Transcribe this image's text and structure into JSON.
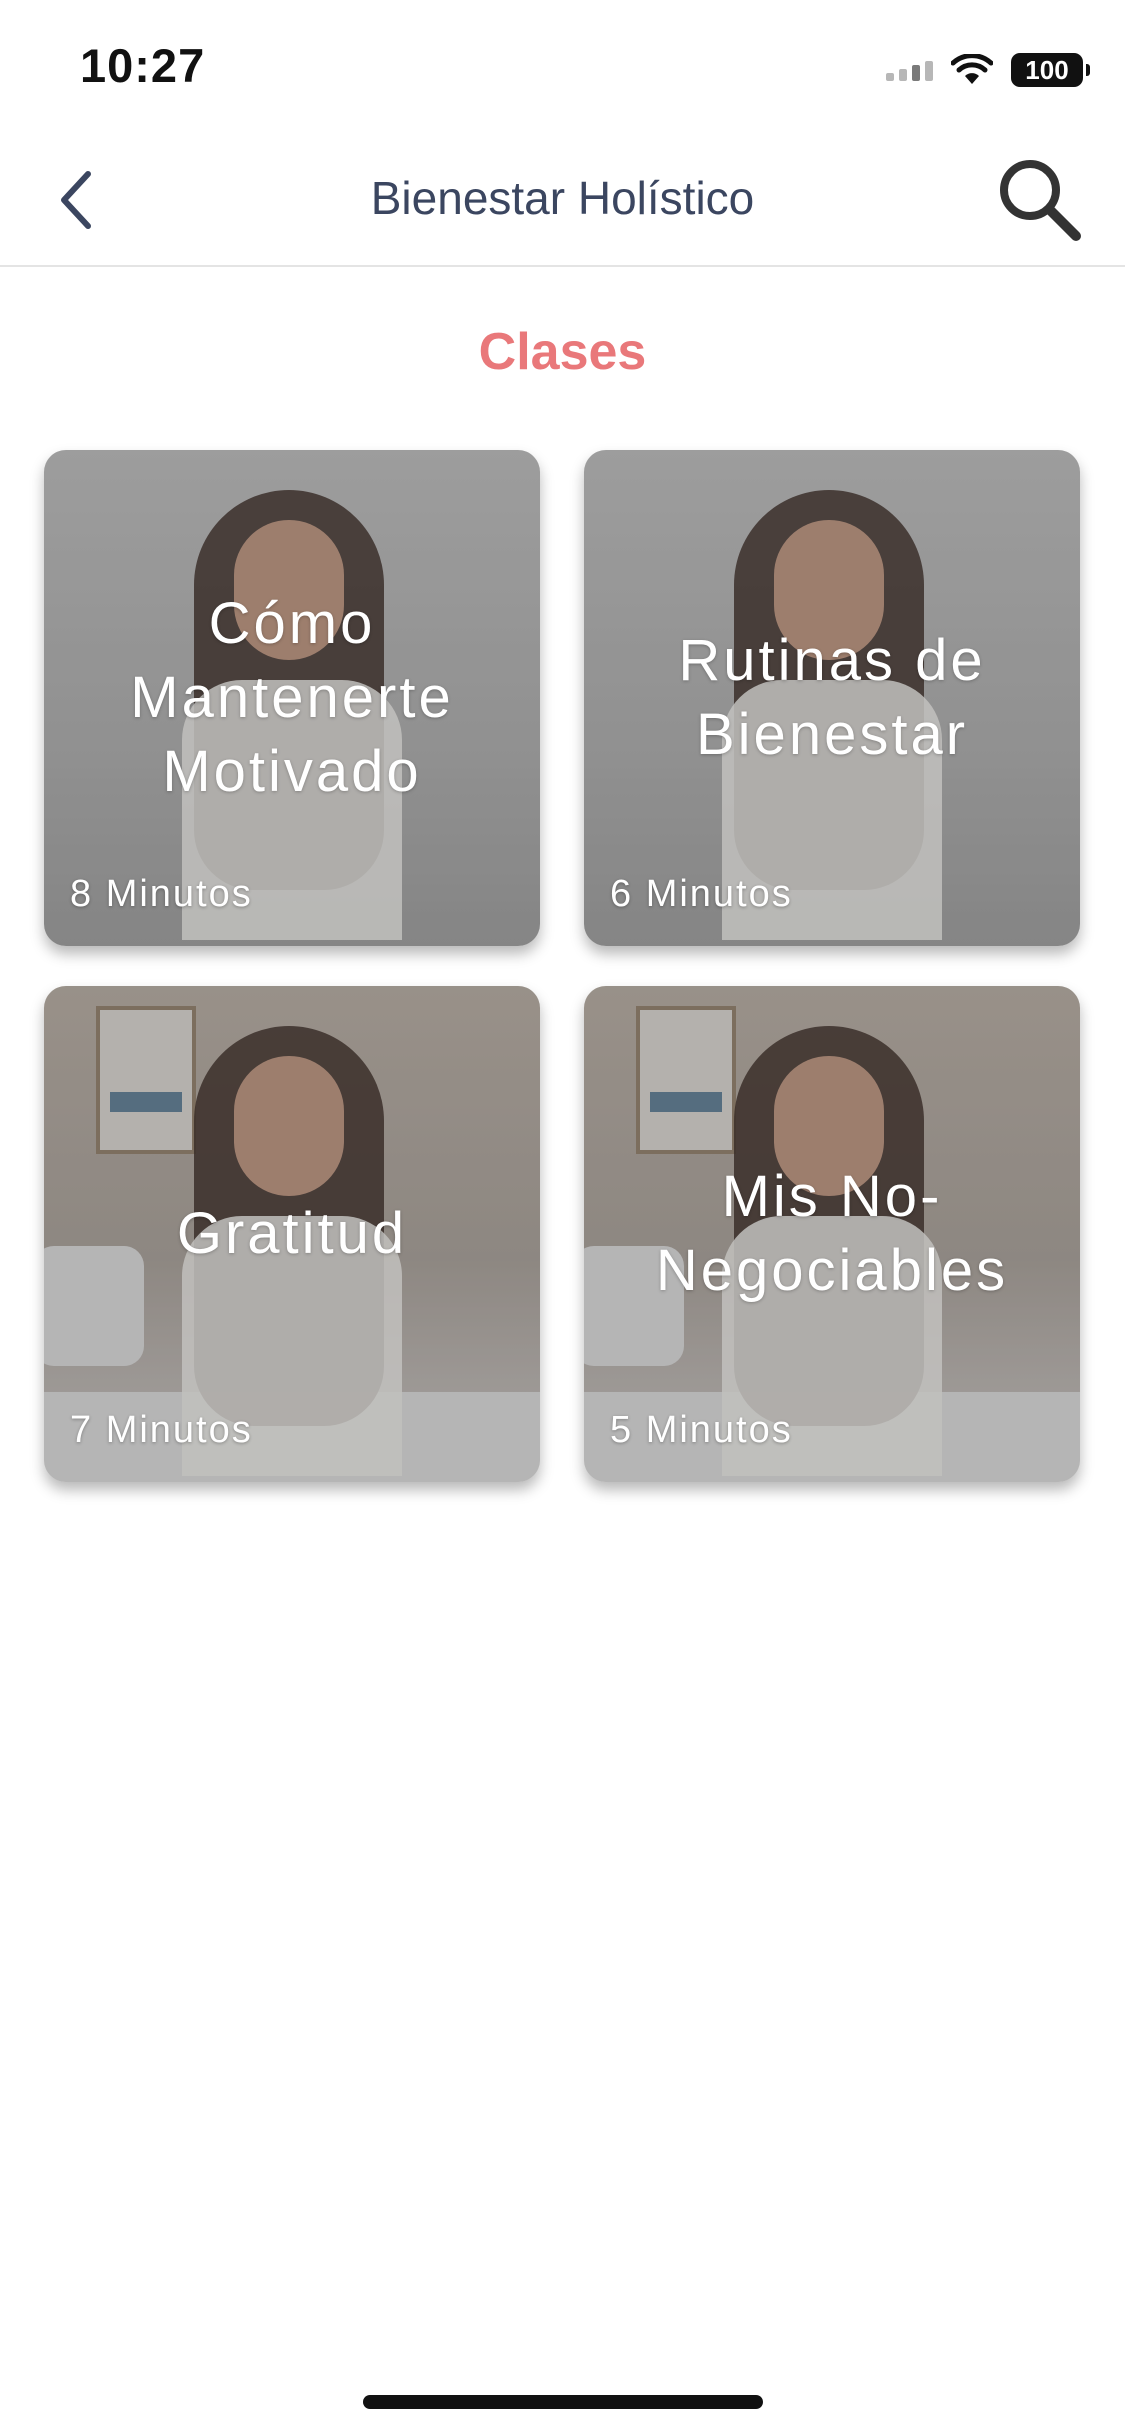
{
  "status_bar": {
    "time": "10:27",
    "battery": "100"
  },
  "nav": {
    "title": "Bienestar Holístico"
  },
  "section": {
    "title": "Clases"
  },
  "cards": [
    {
      "title": "Cómo Mantenerte Motivado",
      "duration": "8 Minutos"
    },
    {
      "title": "Rutinas de Bienestar",
      "duration": "6 Minutos"
    },
    {
      "title": "Gratitud",
      "duration": "7 Minutos"
    },
    {
      "title": "Mis No-Negociables",
      "duration": "5 Minutos"
    }
  ],
  "colors": {
    "accent": "#e9787a",
    "nav_text": "#3b4660",
    "divider": "#e4e4e4"
  },
  "icons": {
    "back": "chevron-left-icon",
    "search": "search-icon"
  }
}
